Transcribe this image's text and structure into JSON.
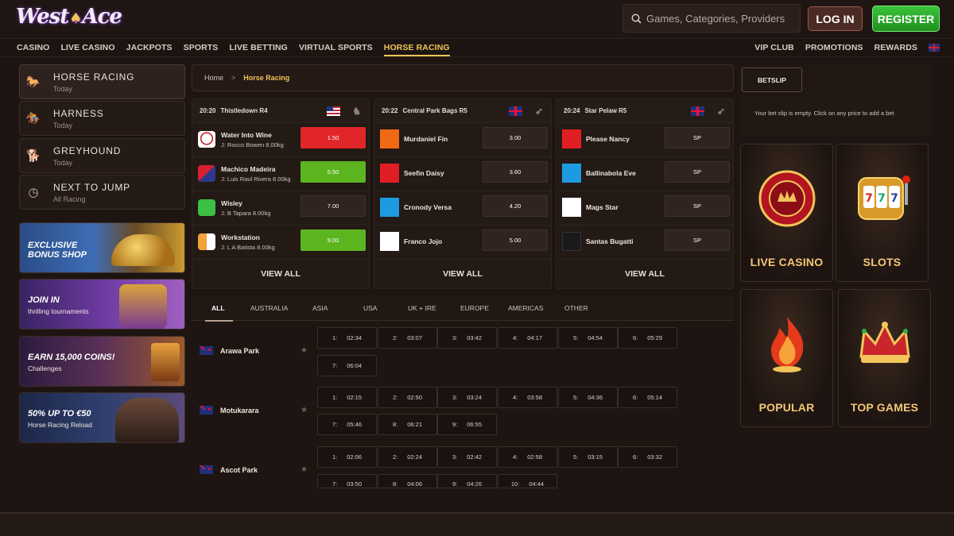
{
  "brand": {
    "logo_text_1": "West",
    "logo_spade": "♠",
    "logo_text_2": "Ace"
  },
  "header": {
    "search_placeholder": "Games, Categories, Providers",
    "login_label": "LOG IN",
    "register_label": "REGISTER"
  },
  "nav": {
    "left": [
      "CASINO",
      "LIVE CASINO",
      "JACKPOTS",
      "SPORTS",
      "LIVE BETTING",
      "VIRTUAL SPORTS",
      "HORSE RACING"
    ],
    "active": "HORSE RACING",
    "right": [
      "VIP CLUB",
      "PROMOTIONS",
      "REWARDS"
    ]
  },
  "sidebar": {
    "categories": [
      {
        "name": "HORSE RACING",
        "sub": "Today",
        "icon": "horse-icon"
      },
      {
        "name": "HARNESS",
        "sub": "Today",
        "icon": "harness-icon"
      },
      {
        "name": "GREYHOUND",
        "sub": "Today",
        "icon": "greyhound-icon"
      },
      {
        "name": "NEXT TO JUMP",
        "sub": "All Racing",
        "icon": "clock-icon"
      }
    ],
    "promos": [
      {
        "title": "EXCLUSIVE BONUS SHOP",
        "title_1": "EXCLUSIVE",
        "title_2": "BONUS SHOP",
        "subtitle": ""
      },
      {
        "title": "JOIN IN",
        "subtitle": "thrilling tournaments"
      },
      {
        "title": "EARN 15,000 COINS!",
        "subtitle": "Challenges"
      },
      {
        "title": "50% UP TO €50",
        "subtitle": "Horse Racing Reload"
      }
    ]
  },
  "breadcrumb": {
    "home": "Home",
    "separator": ">",
    "current": "Horse Racing"
  },
  "races": [
    {
      "time": "20:20",
      "name": "Thistledown R4",
      "country": "US",
      "runners": [
        {
          "name": "Water Into Wine",
          "jockey": "J: Rocco Bowen 8.00kg",
          "price": "1.50",
          "price_style": "red",
          "silk_color": "#ffffff"
        },
        {
          "name": "Machico Madeira",
          "jockey": "J: Luis Raul Rivera 8.00kg",
          "price": "5.50",
          "price_style": "green",
          "silk_color": "#d6202f"
        },
        {
          "name": "Wisley",
          "jockey": "J: B Tapara 8.00kg",
          "price": "7.00",
          "price_style": "plain",
          "silk_color": "#3bbf45"
        },
        {
          "name": "Workstation",
          "jockey": "J: L A Batista 8.00kg",
          "price": "9.00",
          "price_style": "green",
          "silk_color": "#f2a23a"
        }
      ],
      "view_all": "VIEW ALL"
    },
    {
      "time": "20:22",
      "name": "Central Park Bags R5",
      "country": "GB",
      "runners": [
        {
          "name": "Murdaniel Fin",
          "price": "3.00",
          "color": "#f06a14"
        },
        {
          "name": "Seefin Daisy",
          "price": "3.60",
          "color": "#e21e25"
        },
        {
          "name": "Cronody Versa",
          "price": "4.20",
          "color": "#1e9be0"
        },
        {
          "name": "Franco Jojo",
          "price": "5.00",
          "color": "#ffffff"
        }
      ],
      "view_all": "VIEW ALL"
    },
    {
      "time": "20:24",
      "name": "Star Pelaw R5",
      "country": "GB",
      "runners": [
        {
          "name": "Please Nancy",
          "price": "SP",
          "color": "#e21e25"
        },
        {
          "name": "Ballinabola Eve",
          "price": "SP",
          "color": "#1e9be0"
        },
        {
          "name": "Mags Star",
          "price": "SP",
          "color": "#ffffff"
        },
        {
          "name": "Santas Bugatti",
          "price": "SP",
          "color": "#1a1a1a"
        }
      ],
      "view_all": "VIEW ALL"
    }
  ],
  "region_tabs": [
    "ALL",
    "AUSTRALIA",
    "ASIA",
    "USA",
    "UK + IRE",
    "EUROPE",
    "AMERICAS",
    "OTHER"
  ],
  "active_region": "ALL",
  "meetings": [
    {
      "name": "Arawa Park",
      "races": [
        [
          "1:",
          "02:34"
        ],
        [
          "2:",
          "03:07"
        ],
        [
          "3:",
          "03:42"
        ],
        [
          "4:",
          "04:17"
        ],
        [
          "5:",
          "04:54"
        ],
        [
          "6:",
          "05:29"
        ],
        [
          "7:",
          "06:04"
        ]
      ]
    },
    {
      "name": "Motukarara",
      "races": [
        [
          "1:",
          "02:15"
        ],
        [
          "2:",
          "02:50"
        ],
        [
          "3:",
          "03:24"
        ],
        [
          "4:",
          "03:58"
        ],
        [
          "5:",
          "04:36"
        ],
        [
          "6:",
          "05:14"
        ],
        [
          "7:",
          "05:46"
        ],
        [
          "8:",
          "06:21"
        ],
        [
          "9:",
          "06:55"
        ]
      ]
    },
    {
      "name": "Ascot Park",
      "races": [
        [
          "1:",
          "02:06"
        ],
        [
          "2:",
          "02:24"
        ],
        [
          "3:",
          "02:42"
        ],
        [
          "4:",
          "02:58"
        ],
        [
          "5:",
          "03:15"
        ],
        [
          "6:",
          "03:32"
        ],
        [
          "7:",
          "03:50"
        ],
        [
          "8:",
          "04:06"
        ],
        [
          "9:",
          "04:26"
        ],
        [
          "10:",
          "04:44"
        ]
      ]
    }
  ],
  "betslip": {
    "tab": "BETSLIP",
    "empty_message": "Your bet slip is empty. Click on any price to add a bet"
  },
  "game_tiles": [
    {
      "label": "LIVE CASINO",
      "icon": "poker-chip-icon"
    },
    {
      "label": "SLOTS",
      "icon": "slot-machine-icon"
    },
    {
      "label": "POPULAR",
      "icon": "flame-icon"
    },
    {
      "label": "TOP GAMES",
      "icon": "crown-icon"
    }
  ]
}
